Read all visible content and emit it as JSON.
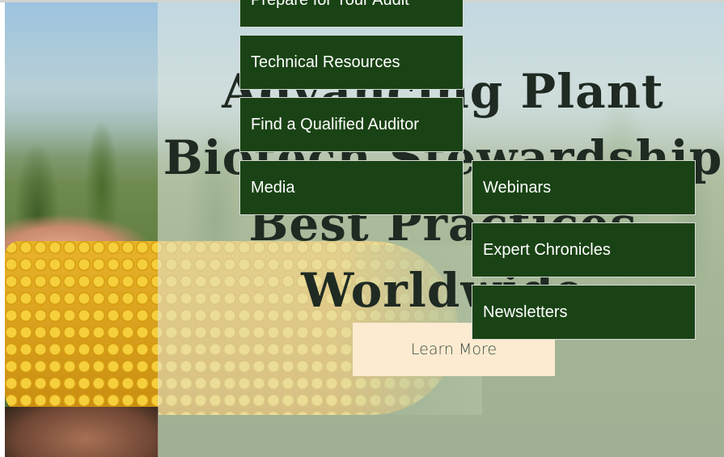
{
  "hero": {
    "headline_lines": [
      "Advancing Plant",
      "Biotech Stewardship",
      "Best Practices",
      "Worldwide"
    ],
    "cta_label": "Learn More"
  },
  "menu": {
    "items": [
      {
        "label": "Prepare for Your Audit"
      },
      {
        "label": "Technical Resources"
      },
      {
        "label": "Find a Qualified Auditor"
      },
      {
        "label": "Media"
      }
    ],
    "submenu": [
      {
        "label": "Webinars"
      },
      {
        "label": "Expert Chronicles"
      },
      {
        "label": "Newsletters"
      }
    ]
  },
  "colors": {
    "menu_background": "#1a4315",
    "cta_background": "#fcebd0",
    "headline_text": "#1f2a22"
  }
}
